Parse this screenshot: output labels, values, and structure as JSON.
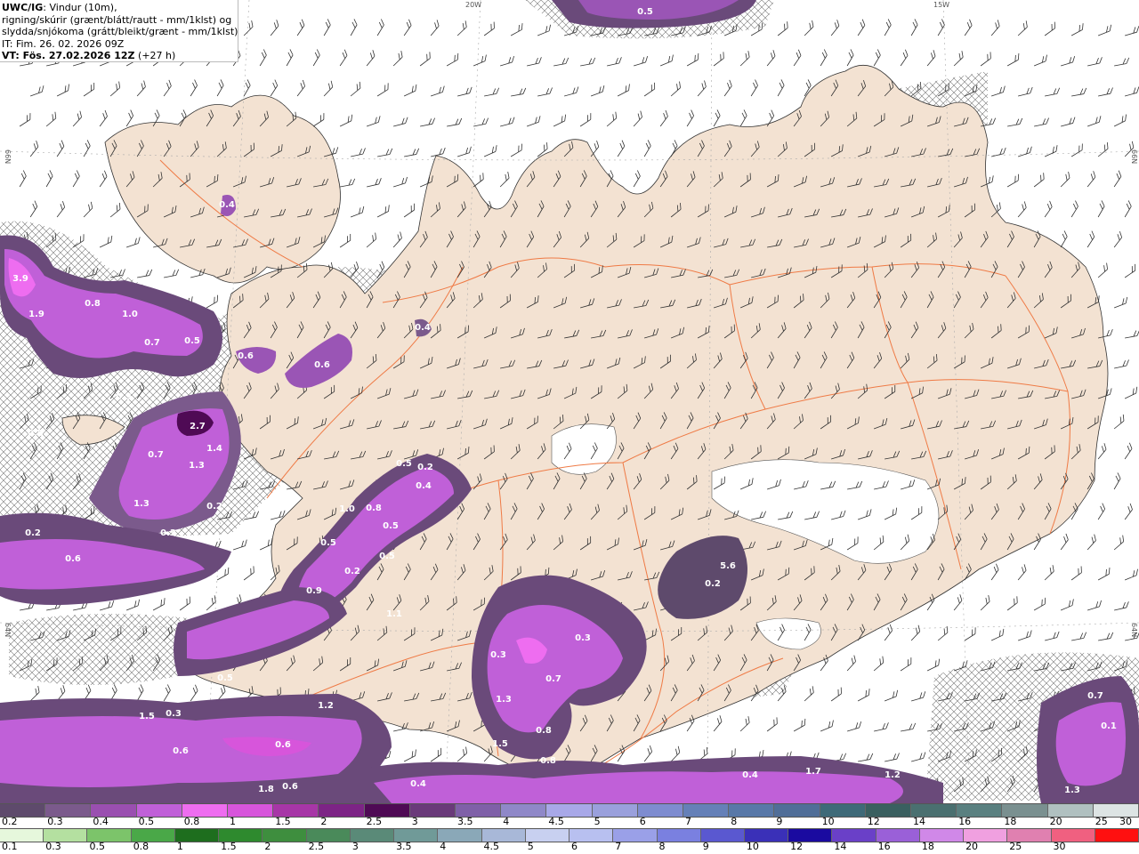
{
  "header": {
    "model": "UWC/IG",
    "desc1": ": Vindur (10m),",
    "desc2": "rigning/skúrir (grænt/blátt/rautt - mm/1klst) og",
    "desc3": "slydda/snjókoma (grátt/bleikt/grænt - mm/1klst)",
    "init_time": "IT: Fim. 26. 02. 2026 09Z",
    "valid_prefix": "VT: Fös. 27.02.2026 12Z",
    "lead": " (+27 h)"
  },
  "grid_labels": [
    "20W",
    "15W",
    "66N",
    "66N",
    "64N",
    "64N"
  ],
  "precip_labels": [
    "0.5",
    "0.4",
    "3.9",
    "1.9",
    "0.8",
    "1.0",
    "0.7",
    "0.5",
    "0.6",
    "0.6",
    "0.5",
    "0.4",
    "2.7",
    "0.7",
    "1.4",
    "1.3",
    "1.3",
    "0.2",
    "0.3",
    "0.2",
    "0.6",
    "0.5",
    "0.2",
    "1.0",
    "0.8",
    "0.5",
    "0.5",
    "0.5",
    "0.2",
    "0.9",
    "1.1",
    "5.6",
    "0.2",
    "0.3",
    "0.3",
    "0.7",
    "1.3",
    "0.8",
    "1.5",
    "0.8",
    "1.2",
    "1.5",
    "0.3",
    "0.6",
    "0.6",
    "1.8",
    "0.6",
    "0.4",
    "0.4",
    "1.7",
    "1.2",
    "0.7",
    "0.1",
    "1.3",
    "0.5",
    "0.7",
    "0.5",
    "0.4"
  ],
  "colorbar_snow": {
    "colors": [
      "#5e4a6c",
      "#7b5a8c",
      "#9a4fb0",
      "#c060d8",
      "#ee6df0",
      "#d755db",
      "#a736a7",
      "#7d2486",
      "#4f0a55",
      "#6a3a7a",
      "#7f60a8",
      "#8f88c8",
      "#a8a8e8",
      "#9aa0dc",
      "#7e8cd0",
      "#6580b8",
      "#5878a8",
      "#506e98",
      "#3e6a78",
      "#3a6060",
      "#4a7070",
      "#5a8080",
      "#7a9090",
      "#b0c0c0",
      "#dde4e4"
    ],
    "labels": [
      "0.2",
      "0.3",
      "0.4",
      "0.5",
      "0.8",
      "1",
      "1.5",
      "2",
      "2.5",
      "3",
      "3.5",
      "4",
      "4.5",
      "5",
      "6",
      "7",
      "8",
      "9",
      "10",
      "12",
      "14",
      "16",
      "18",
      "20",
      "25",
      "30"
    ]
  },
  "colorbar_rain": {
    "colors": [
      "#e6f7dc",
      "#b4e0a0",
      "#7cc46a",
      "#4aa848",
      "#1e6e1e",
      "#2e8a2e",
      "#3e8e3e",
      "#4a8a5a",
      "#5a8a78",
      "#709a98",
      "#8aa8b8",
      "#a8b8d8",
      "#c8d0f0",
      "#b8c0f0",
      "#9aa0e8",
      "#7a80e0",
      "#5a58d0",
      "#3a30b8",
      "#1a0aa0",
      "#6a40c8",
      "#9a60d8",
      "#d088e8",
      "#f0a0e0",
      "#e080b0",
      "#f06080",
      "#ff1010"
    ],
    "labels": [
      "0.1",
      "0.3",
      "0.5",
      "0.8",
      "1",
      "1.5",
      "2",
      "2.5",
      "3",
      "3.5",
      "4",
      "4.5",
      "5",
      "6",
      "7",
      "8",
      "9",
      "10",
      "12",
      "14",
      "16",
      "18",
      "20",
      "25",
      "30"
    ]
  }
}
